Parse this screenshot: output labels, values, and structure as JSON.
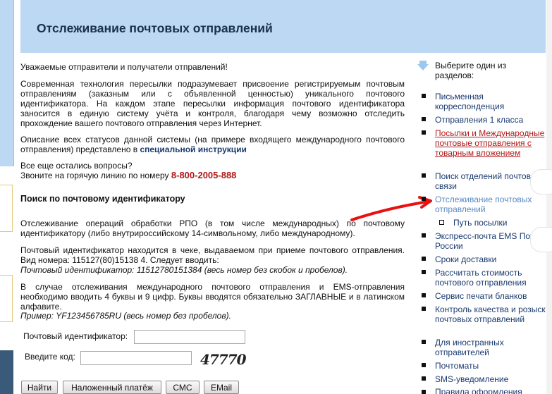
{
  "header": {
    "title": "Отслеживание почтовых отправлений"
  },
  "intro": {
    "greeting": "Уважаемые отправители и получатели отправлений!",
    "tech_text": "Современная технология пересылки подразумевает присвоение регистрируемым почтовым отправлениям (заказным или с объявленной ценностью) уникального почтового идентификатора. На каждом этапе пересылки информация почтового идентификатора заносится в единую систему учёта и контроля, благодаря чему возможно отследить прохождение вашего почтового отправления через Интернет.",
    "desc_prefix": "Описание всех статусов данной системы (на примере входящего международного почтового отправления) представлено в ",
    "desc_link": "специальной инструкции",
    "questions": "Все еще остались вопросы?",
    "hotline_prefix": "Звоните на горячую линию по номеру ",
    "hotline_number": "8-800-2005-888"
  },
  "search": {
    "title": "Поиск по почтовому идентификатору",
    "para1": "Отслеживание операций обработки РПО (в том числе международных) по почтовому идентификатору (либо внутрироссийскому 14-символьному, либо международному).",
    "para2": "Почтовый идентификатор находится в чеке, выдаваемом при приеме почтового отправления. Вид номера: 115127(80)15138 4. Следует вводить:",
    "example1": "Почтовый идентификатор: 11512780151384 (весь номер без скобок и пробелов).",
    "para3": "В случае отслеживания международного почтового отправления и EMS-отправления необходимо вводить 4 буквы и 9 цифр. Буквы вводятся обязательно ЗАГЛАВНЫЕ и в латинском алфавите.",
    "example2": "Пример: YF123456785RU (весь номер без пробелов).",
    "id_label": "Почтовый идентификатор:",
    "id_value": "",
    "code_label": "Введите код:",
    "code_value": "",
    "captcha": "47770"
  },
  "buttons": {
    "find": "Найти",
    "cod": "Наложенный платёж",
    "sms": "СМС",
    "email": "EMail"
  },
  "sidebar": {
    "heading": "Выберите один из разделов:",
    "items": [
      "Письменная корреспонденция",
      "Отправления 1 класса",
      "Посылки и Международные почтовые отправления с товарным вложением",
      "Поиск отделений почтовой связи",
      "Отслеживание почтовых отправлений",
      "Экспресс-почта EMS Почта России",
      "Сроки доставки",
      "Рассчитать стоимость почтового отправления",
      "Сервис печати бланков",
      "Контроль качества и розыск почтовых отправлений",
      "Для иностранных отправителей",
      "Почтоматы",
      "SMS-уведомление",
      "Правила оформления"
    ],
    "subitem": "Путь посылки"
  },
  "colors": {
    "header_bg": "#bcd8f2",
    "link": "#1a3a6e",
    "hotline": "#b01818",
    "annotation_arrow": "#e81010"
  }
}
